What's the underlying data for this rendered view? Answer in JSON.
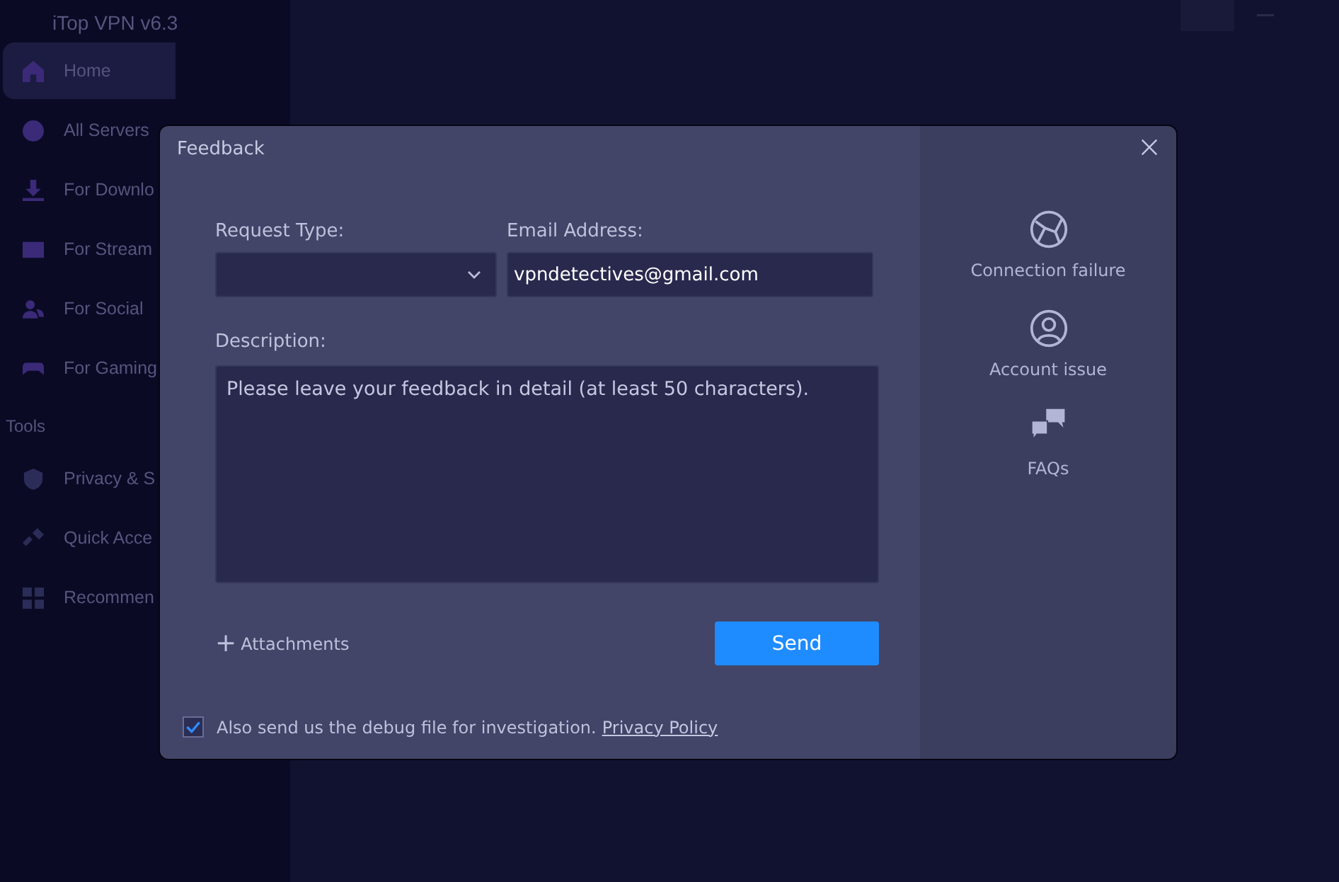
{
  "app": {
    "title": "iTop VPN v6.3",
    "sidebar": {
      "items": [
        {
          "label": "Home",
          "selected": true
        },
        {
          "label": "All Servers",
          "selected": false
        },
        {
          "label": "For Downlo",
          "selected": false
        },
        {
          "label": "For Stream",
          "selected": false
        },
        {
          "label": "For Social",
          "selected": false
        },
        {
          "label": "For Gaming",
          "selected": false
        }
      ],
      "section": "Tools",
      "tools": [
        {
          "label": "Privacy & S"
        },
        {
          "label": "Quick Acce"
        },
        {
          "label": "Recommen"
        }
      ]
    }
  },
  "dialog": {
    "title": "Feedback",
    "request_type": {
      "label": "Request Type:"
    },
    "email": {
      "label": "Email Address:",
      "value": "vpndetectives@gmail.com"
    },
    "description": {
      "label": "Description:",
      "placeholder": "Please leave your feedback in detail (at least 50 characters)."
    },
    "attachments": {
      "icon": "+",
      "label": "Attachments"
    },
    "send": "Send",
    "debug": {
      "checked": true,
      "text": "Also send us the debug file for investigation.",
      "link": "Privacy Policy"
    },
    "topics": [
      {
        "label": "Connection failure"
      },
      {
        "label": "Account issue"
      },
      {
        "label": "FAQs"
      }
    ]
  }
}
